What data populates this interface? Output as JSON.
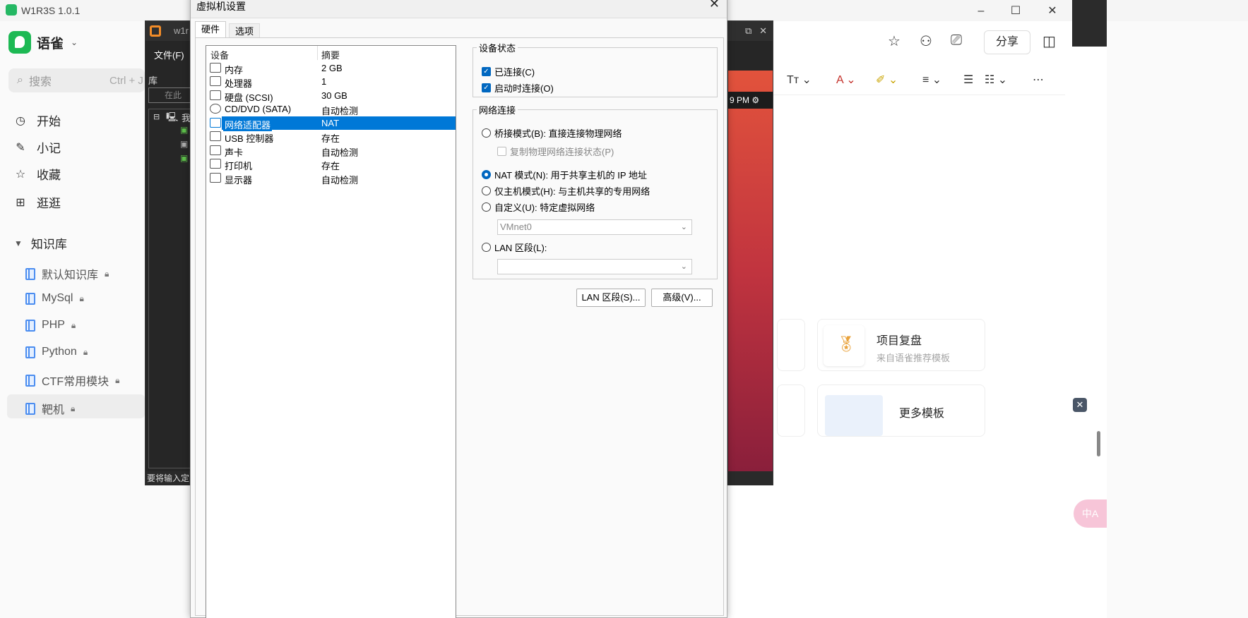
{
  "yuque": {
    "app_title": "W1R3S 1.0.1",
    "brand": "语雀",
    "search_placeholder": "搜索",
    "search_shortcut": "Ctrl + J",
    "nav": [
      {
        "icon": "clock-icon",
        "label": "开始"
      },
      {
        "icon": "leaf-icon",
        "label": "小记"
      },
      {
        "icon": "star-icon",
        "label": "收藏"
      },
      {
        "icon": "grid-icon",
        "label": "逛逛"
      }
    ],
    "kb_header": "知识库",
    "kb_items": [
      "默认知识库",
      "MySql",
      "PHP",
      "Python",
      "CTF常用模块",
      "靶机"
    ],
    "share_label": "分享",
    "templates": [
      {
        "title": "项目复盘",
        "subtitle": "来自语雀推荐模板"
      },
      {
        "title": "更多模板",
        "subtitle": ""
      }
    ],
    "translate": "中A"
  },
  "vmware": {
    "title": "w1r",
    "menu_file": "文件(F)",
    "library_label": "库",
    "library_search": "在此",
    "tree_root": "我",
    "status_text": "要将输入定",
    "clock_text": "9 PM"
  },
  "dialog": {
    "title": "虚拟机设置",
    "tabs": [
      "硬件",
      "选项"
    ],
    "device_col": "设备",
    "summary_col": "摘要",
    "devices": [
      {
        "name": "内存",
        "summary": "2 GB",
        "icon": "memory-icon"
      },
      {
        "name": "处理器",
        "summary": "1",
        "icon": "cpu-icon"
      },
      {
        "name": "硬盘 (SCSI)",
        "summary": "30 GB",
        "icon": "harddisk-icon"
      },
      {
        "name": "CD/DVD (SATA)",
        "summary": "自动检测",
        "icon": "cd-icon"
      },
      {
        "name": "网络适配器",
        "summary": "NAT",
        "icon": "network-icon"
      },
      {
        "name": "USB 控制器",
        "summary": "存在",
        "icon": "usb-icon"
      },
      {
        "name": "声卡",
        "summary": "自动检测",
        "icon": "sound-icon"
      },
      {
        "name": "打印机",
        "summary": "存在",
        "icon": "printer-icon"
      },
      {
        "name": "显示器",
        "summary": "自动检测",
        "icon": "monitor-icon"
      }
    ],
    "selected_device": "网络适配器",
    "device_status": {
      "legend": "设备状态",
      "connected": "已连接(C)",
      "connect_at_power_on": "启动时连接(O)"
    },
    "network": {
      "legend": "网络连接",
      "bridged": "桥接模式(B): 直接连接物理网络",
      "replicate": "复制物理网络连接状态(P)",
      "nat": "NAT 模式(N): 用于共享主机的 IP 地址",
      "host_only": "仅主机模式(H): 与主机共享的专用网络",
      "custom": "自定义(U): 特定虚拟网络",
      "custom_value": "VMnet0",
      "lan_segment": "LAN 区段(L):",
      "lan_value": ""
    },
    "buttons": {
      "lan_segments": "LAN 区段(S)...",
      "advanced": "高级(V)..."
    }
  }
}
